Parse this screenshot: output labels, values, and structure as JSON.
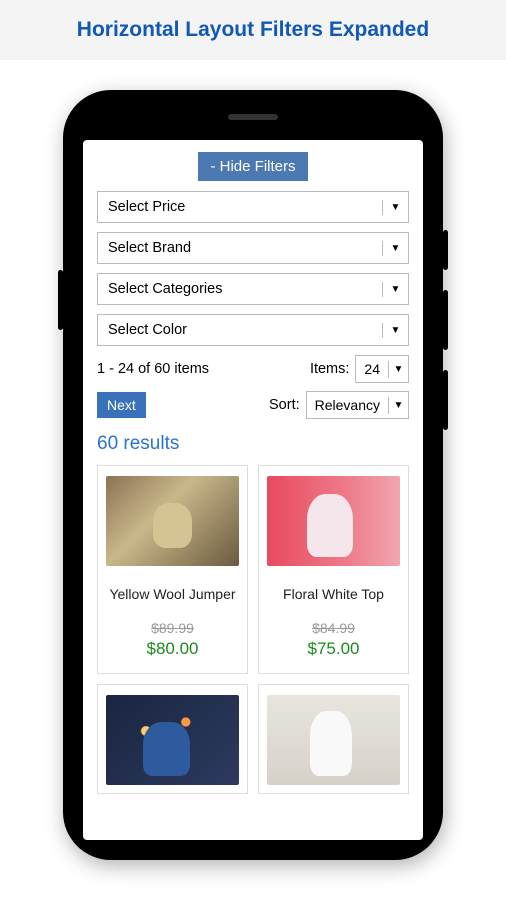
{
  "header": {
    "title": "Horizontal Layout Filters Expanded"
  },
  "filters": {
    "toggle_label": "- Hide Filters",
    "selects": [
      {
        "label": "Select Price"
      },
      {
        "label": "Select Brand"
      },
      {
        "label": "Select Categories"
      },
      {
        "label": "Select Color"
      }
    ]
  },
  "pagination": {
    "range_text": "1 - 24 of 60 items",
    "items_label": "Items:",
    "items_value": "24",
    "next_label": "Next",
    "sort_label": "Sort:",
    "sort_value": "Relevancy"
  },
  "results": {
    "count_text": "60 results"
  },
  "products": [
    {
      "name": "Yellow Wool Jumper",
      "old_price": "$89.99",
      "new_price": "$80.00"
    },
    {
      "name": "Floral White Top",
      "old_price": "$84.99",
      "new_price": "$75.00"
    },
    {
      "name": "",
      "old_price": "",
      "new_price": ""
    },
    {
      "name": "",
      "old_price": "",
      "new_price": ""
    }
  ]
}
